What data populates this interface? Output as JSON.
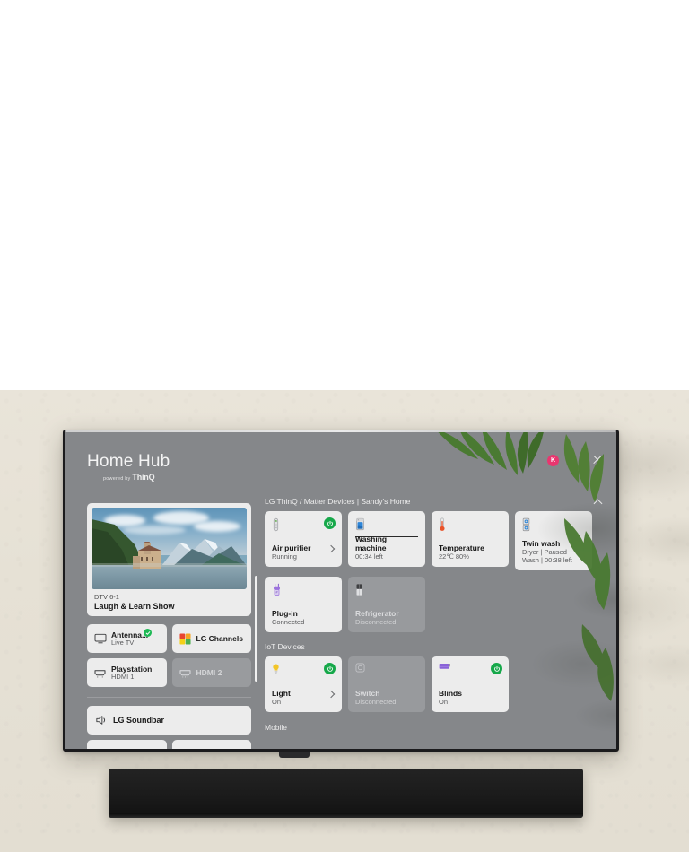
{
  "app": {
    "title": "Home Hub",
    "subtitle_prefix": "powered by",
    "subtitle_brand": "ThinQ"
  },
  "header": {
    "avatar_initial": "K",
    "avatar_color": "#e8366f",
    "kebab_label": "more-options",
    "close_label": "close"
  },
  "preview": {
    "channel": "DTV 6-1",
    "program": "Laugh & Learn Show"
  },
  "inputs": [
    {
      "name": "Antenna...",
      "sub": "Live TV",
      "icon": "tv-icon",
      "state": "active",
      "checked": true
    },
    {
      "name": "LG Channels",
      "sub": "",
      "icon": "lg-channels-icon",
      "state": "active",
      "checked": false
    },
    {
      "name": "Playstation",
      "sub": "HDMI 1",
      "icon": "hdmi-icon",
      "state": "active",
      "checked": false
    },
    {
      "name": "HDMI 2",
      "sub": "",
      "icon": "hdmi-icon",
      "state": "disabled",
      "checked": false
    }
  ],
  "audio": {
    "name": "LG Soundbar",
    "icon": "speaker-icon"
  },
  "sections": [
    {
      "title": "LG ThinQ / Matter Devices | Sandy's Home",
      "collapse_icon": "chevron-up-icon",
      "rows": [
        [
          {
            "name": "Air purifier",
            "sub": "Running",
            "icon": "air-purifier-icon",
            "power": true,
            "arrow": true,
            "progress": false,
            "state": "active"
          },
          {
            "name": "Washing machine",
            "sub": "00:34 left",
            "icon": "washer-icon",
            "power": false,
            "arrow": false,
            "progress": true,
            "state": "active"
          },
          {
            "name": "Temperature",
            "sub": "22℃ 80%",
            "icon": "thermometer-icon",
            "power": false,
            "arrow": false,
            "progress": false,
            "state": "active"
          },
          {
            "name": "Twin wash",
            "sub": "Dryer | Paused\nWash | 00:38 left",
            "icon": "twin-wash-icon",
            "power": false,
            "arrow": false,
            "progress": false,
            "state": "active",
            "tall": true
          }
        ],
        [
          {
            "name": "Plug-in",
            "sub": "Connected",
            "icon": "plug-icon",
            "power": false,
            "arrow": false,
            "progress": false,
            "state": "active"
          },
          {
            "name": "Refrigerator",
            "sub": "Disconnected",
            "icon": "fridge-icon",
            "power": false,
            "arrow": false,
            "progress": false,
            "state": "disabled"
          }
        ]
      ]
    },
    {
      "title": "IoT Devices",
      "rows": [
        [
          {
            "name": "Light",
            "sub": "On",
            "icon": "bulb-icon",
            "power": true,
            "arrow": true,
            "progress": false,
            "state": "active"
          },
          {
            "name": "Switch",
            "sub": "Disconnected",
            "icon": "switch-icon",
            "power": false,
            "arrow": false,
            "progress": false,
            "state": "disabled"
          },
          {
            "name": "Blinds",
            "sub": "On",
            "icon": "blinds-icon",
            "power": true,
            "arrow": false,
            "progress": false,
            "state": "active"
          }
        ]
      ]
    },
    {
      "title": "Mobile",
      "rows": []
    }
  ],
  "colors": {
    "screen_bg": "#85878a",
    "card_bg": "#ececec",
    "card_dim_bg": "#a8aaad",
    "power_green": "#16a84a",
    "check_green": "#1db954",
    "wall": "#e6e1d5",
    "bezel": "#1b1b1d"
  }
}
